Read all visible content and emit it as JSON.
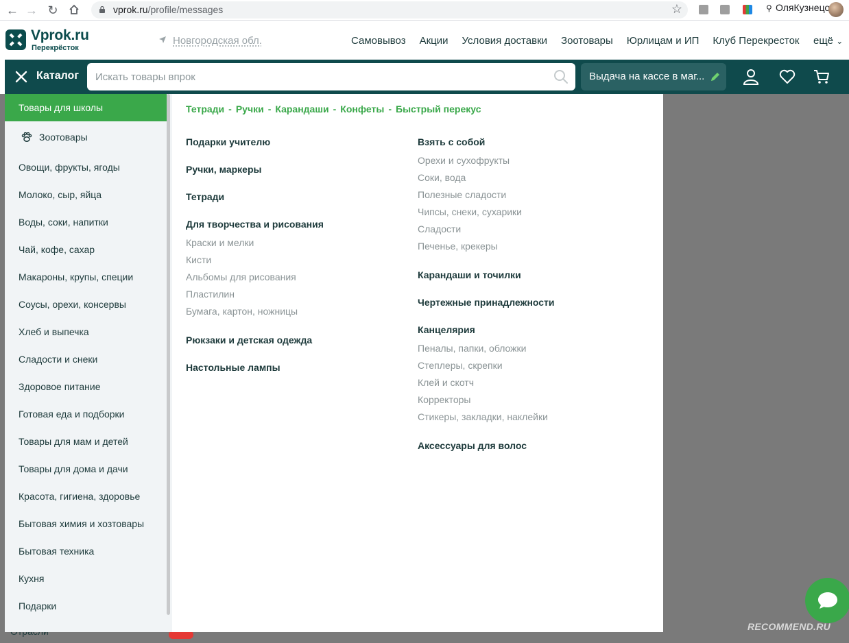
{
  "browser": {
    "url_host": "vprok.ru",
    "url_path": "/profile/messages",
    "profile_name": "ОляКузнецова"
  },
  "header": {
    "logo_title": "Vprok.ru",
    "logo_sub": "Перекрёсток",
    "region": "Новгородская обл.",
    "links": [
      "Самовывоз",
      "Акции",
      "Условия доставки",
      "Зоотовары",
      "Юрлицам и ИП",
      "Клуб Перекресток"
    ],
    "more": "ещё"
  },
  "toolbar": {
    "catalog_label": "Каталог",
    "search_placeholder": "Искать товары впрок",
    "delivery_label": "Выдача на кассе в маг..."
  },
  "menu": {
    "items": [
      "Товары для школы",
      "Зоотовары",
      "Овощи, фрукты, ягоды",
      "Молоко, сыр, яйца",
      "Воды, соки, напитки",
      "Чай, кофе, сахар",
      "Макароны, крупы, специи",
      "Соусы, орехи, консервы",
      "Хлеб и выпечка",
      "Сладости и снеки",
      "Здоровое питание",
      "Готовая еда и подборки",
      "Товары для мам и детей",
      "Товары для дома и дачи",
      "Красота, гигиена, здоровье",
      "Бытовая химия и хозтовары",
      "Бытовая техника",
      "Кухня",
      "Подарки"
    ],
    "cut_item": "Отрасли"
  },
  "panel": {
    "tags": [
      "Тетради",
      "Ручки",
      "Карандаши",
      "Конфеты",
      "Быстрый перекус"
    ],
    "left": {
      "h1": "Подарки учителю",
      "h2": "Ручки, маркеры",
      "h3": "Тетради",
      "h4": "Для творчества и рисования",
      "h4_links": [
        "Краски и мелки",
        "Кисти",
        "Альбомы для рисования",
        "Пластилин",
        "Бумага, картон, ножницы"
      ],
      "h5": "Рюкзаки и детская одежда",
      "h6": "Настольные лампы"
    },
    "right": {
      "h1": "Взять с собой",
      "h1_links": [
        "Орехи и сухофрукты",
        "Соки, вода",
        "Полезные сладости",
        "Чипсы, снеки, сухарики",
        "Сладости",
        "Печенье, крекеры"
      ],
      "h2": "Карандаши и точилки",
      "h3": "Чертежные принадлежности",
      "h4": "Канцелярия",
      "h4_links": [
        "Пеналы, папки, обложки",
        "Степлеры, скрепки",
        "Клей и скотч",
        "Корректоры",
        "Стикеры, закладки, наклейки"
      ],
      "h5": "Аксессуары для волос"
    }
  },
  "watermark": "RECOMMEND.RU",
  "colors": {
    "brand_dark": "#0f4a4c",
    "brand_green": "#3aa84a",
    "overlay": "#7a7a7a"
  }
}
